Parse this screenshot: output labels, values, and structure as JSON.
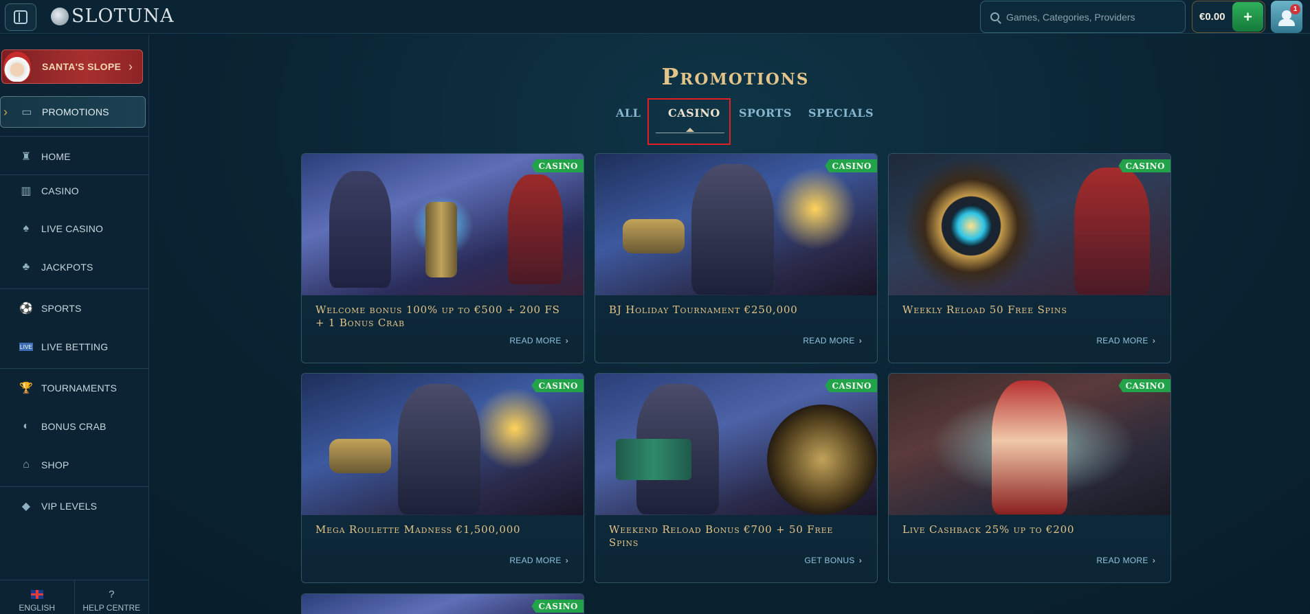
{
  "header": {
    "logo_text": "SLOTUNA",
    "search_placeholder": "Games, Categories, Providers",
    "balance": "€0.00",
    "deposit_icon": "wallet-plus-icon",
    "profile_icon": "user-icon",
    "notification_count": "1"
  },
  "sidebar": {
    "promo_banner": "SANTA'S SLOPE",
    "items": [
      {
        "label": "PROMOTIONS",
        "icon": "treasure-chest-icon"
      },
      {
        "label": "HOME",
        "icon": "castle-icon"
      },
      {
        "label": "CASINO",
        "icon": "slot-machine-icon"
      },
      {
        "label": "LIVE CASINO",
        "icon": "cards-icon"
      },
      {
        "label": "JACKPOTS",
        "icon": "clover-icon"
      },
      {
        "label": "SPORTS",
        "icon": "soccer-ball-icon"
      },
      {
        "label": "LIVE BETTING",
        "icon": "live-badge-icon"
      },
      {
        "label": "TOURNAMENTS",
        "icon": "trophy-icon"
      },
      {
        "label": "BONUS CRAB",
        "icon": "crab-claw-icon"
      },
      {
        "label": "SHOP",
        "icon": "shop-icon"
      },
      {
        "label": "VIP LEVELS",
        "icon": "diamond-icon"
      }
    ],
    "footer": {
      "language": "ENGLISH",
      "help": "HELP CENTRE"
    }
  },
  "main": {
    "title": "Promotions",
    "tabs": [
      {
        "label": "ALL"
      },
      {
        "label": "CASINO"
      },
      {
        "label": "SPORTS"
      },
      {
        "label": "SPECIALS"
      }
    ],
    "active_tab": "CASINO",
    "cards": [
      {
        "badge": "CASINO",
        "title": "Welcome bonus 100% up to €500 + 200 FS + 1 Bonus Crab",
        "link": "READ MORE"
      },
      {
        "badge": "CASINO",
        "title": "BJ Holiday Tournament €250,000",
        "link": "READ MORE"
      },
      {
        "badge": "CASINO",
        "title": "Weekly Reload 50 Free Spins",
        "link": "READ MORE"
      },
      {
        "badge": "CASINO",
        "title": "Mega Roulette Madness €1,500,000",
        "link": "READ MORE"
      },
      {
        "badge": "CASINO",
        "title": "Weekend Reload Bonus €700 + 50 Free Spins",
        "link": "GET BONUS"
      },
      {
        "badge": "CASINO",
        "title": "Live Cashback 25% up to €200",
        "link": "READ MORE"
      },
      {
        "badge": "CASINO"
      }
    ]
  },
  "colors": {
    "accent_gold": "#e3c48a",
    "badge_green": "#22a34a",
    "highlight_red": "#e31e24",
    "link_blue": "#8fc4de"
  }
}
